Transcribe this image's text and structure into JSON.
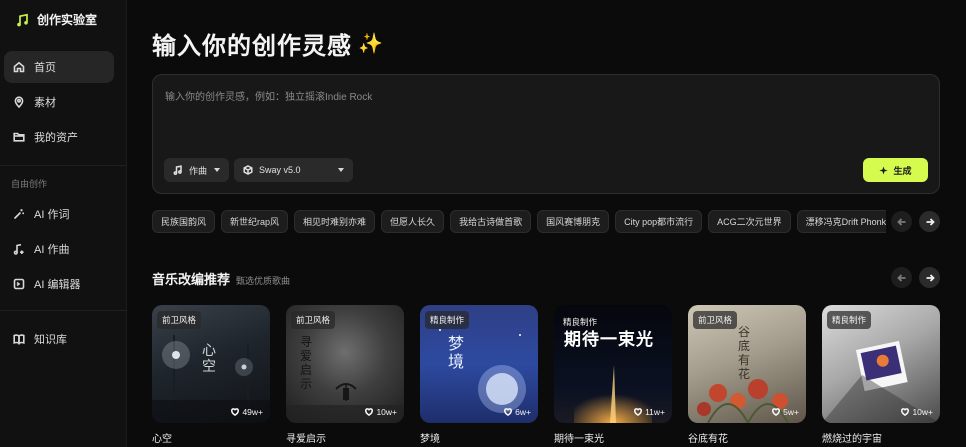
{
  "app": {
    "name": "创作实验室"
  },
  "sidebar": {
    "items": [
      {
        "label": "首页",
        "icon": "home-icon",
        "active": true
      },
      {
        "label": "素材",
        "icon": "location-pin-icon"
      },
      {
        "label": "我的资产",
        "icon": "folder-icon"
      }
    ],
    "section_label": "自由创作",
    "create_items": [
      {
        "label": "AI 作词",
        "icon": "magic-wand-icon"
      },
      {
        "label": "AI 作曲",
        "icon": "music-note-plus-icon"
      },
      {
        "label": "AI 编辑器",
        "icon": "editor-icon"
      }
    ],
    "bottom_items": [
      {
        "label": "知识库",
        "icon": "book-icon"
      }
    ]
  },
  "hero": {
    "title": "输入你的创作灵感"
  },
  "prompt": {
    "placeholder": "输入你的创作灵感，例如：独立摇滚Indie Rock",
    "mode_label": "作曲",
    "model_label": "Sway v5.0",
    "generate_label": "生成"
  },
  "chips": [
    "民族国韵风",
    "新世纪rap风",
    "相见时难别亦难",
    "但愿人长久",
    "我给古诗做首歌",
    "国风赛博朋克",
    "City pop都市流行",
    "ACG二次元世界",
    "漂移冯克Drift Phonk"
  ],
  "recommend": {
    "title": "音乐改编推荐",
    "subtitle": "甄选优质歌曲",
    "cards": [
      {
        "tag": "前卫风格",
        "likes": "49w+",
        "title": "心空",
        "cover_text": "心空"
      },
      {
        "tag": "前卫风格",
        "likes": "10w+",
        "title": "寻爱启示",
        "cover_text": "寻爱启示"
      },
      {
        "tag": "精良制作",
        "likes": "6w+",
        "title": "梦境",
        "cover_text": "梦境"
      },
      {
        "tag": "精良制作",
        "likes": "11w+",
        "title": "期待一束光",
        "cover_text": "期待一束光"
      },
      {
        "tag": "前卫风格",
        "likes": "5w+",
        "title": "谷底有花",
        "cover_text": "谷底有花"
      },
      {
        "tag": "精良制作",
        "likes": "10w+",
        "title": "燃烧过的宇宙",
        "cover_text": ""
      }
    ]
  },
  "colors": {
    "accent": "#d6fb4f",
    "brand_icon": "#c8f04a",
    "background": "#0b0b0b"
  }
}
